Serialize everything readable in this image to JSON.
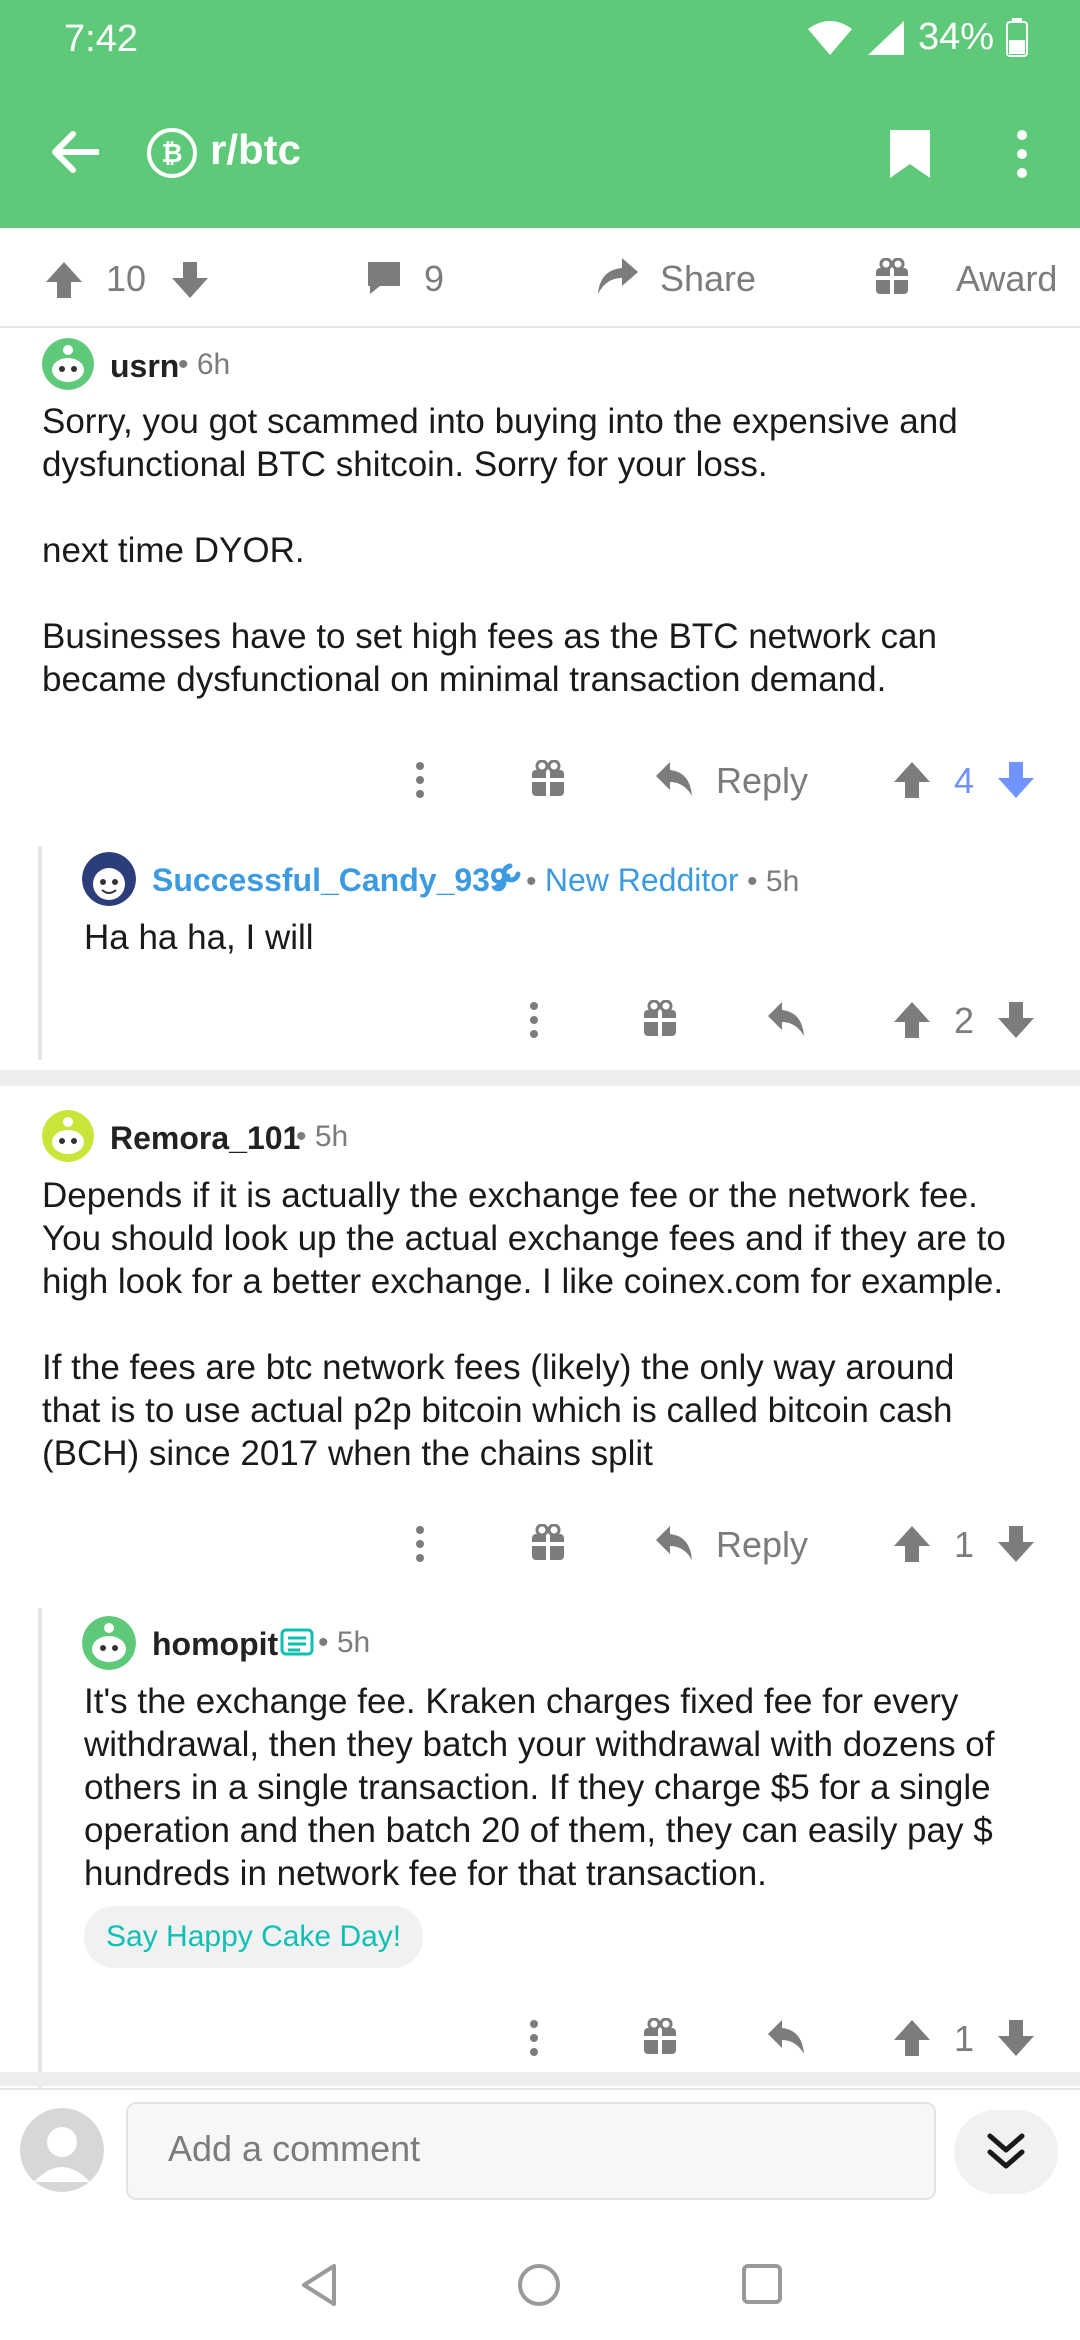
{
  "status": {
    "time": "7:42",
    "battery": "34%"
  },
  "header": {
    "subreddit": "r/btc"
  },
  "actions": {
    "upvotes": "10",
    "comments": "9",
    "share": "Share",
    "award": "Award"
  },
  "comments": [
    {
      "user": "usrn",
      "time": "6h",
      "body": "Sorry, you got scammed into buying into the expensive and\ndysfunctional BTC shitcoin. Sorry for your loss.\n\nnext time DYOR.\n\nBusinesses have to set high fees as the BTC network can\nbecame dysfunctional on minimal transaction demand.",
      "reply": "Reply",
      "score": "4"
    },
    {
      "user": "Successful_Candy_939",
      "flair": "New Redditor",
      "time": "5h",
      "body": "Ha ha ha, I will",
      "score": "2"
    },
    {
      "user": "Remora_101",
      "time": "5h",
      "body": "Depends if it is actually the exchange fee or the network fee.\nYou should look up the actual exchange fees and if they are to\nhigh look for a better exchange. I like coinex.com for example.\n\nIf the fees are btc network fees (likely) the only way around\nthat is to use actual p2p bitcoin which is called bitcoin cash\n(BCH) since 2017 when the chains split",
      "reply": "Reply",
      "score": "1"
    },
    {
      "user": "homopit",
      "time": "5h",
      "body": "It's the exchange fee. Kraken charges fixed fee for every\nwithdrawal, then they batch your withdrawal with dozens of\nothers in a single transaction. If they charge $5 for a single\noperation and then batch 20 of them, they can easily pay $\nhundreds in network fee for that transaction.",
      "chip": "Say Happy Cake Day!",
      "score": "1"
    }
  ],
  "composer": {
    "placeholder": "Add a comment"
  },
  "colors": {
    "header": "#5fc97a",
    "link": "#3c9be0",
    "upvoted_blue": "#7193ff",
    "chip_text": "#0ebfb3"
  }
}
